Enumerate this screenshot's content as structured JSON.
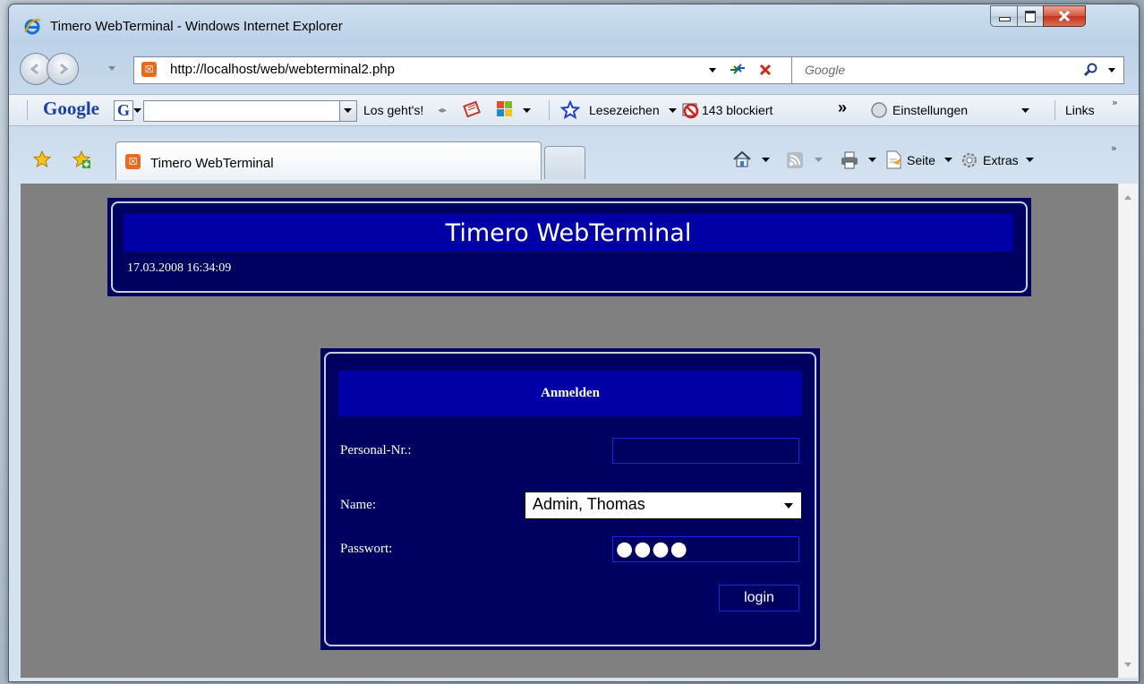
{
  "window": {
    "title": "Timero WebTerminal - Windows Internet Explorer"
  },
  "address_bar": {
    "url": "http://localhost/web/webterminal2.php",
    "search_placeholder": "Google"
  },
  "google_toolbar": {
    "logo": "Google",
    "search_button": "Los geht's!",
    "bookmarks": "Lesezeichen",
    "blocked": "143 blockiert",
    "more": "»",
    "settings": "Einstellungen",
    "links": "Links"
  },
  "tabs": {
    "active_label": "Timero WebTerminal"
  },
  "command_bar": {
    "page_menu": "Seite",
    "tools_menu": "Extras"
  },
  "page": {
    "header_title": "Timero WebTerminal",
    "datetime": "17.03.2008 16:34:09",
    "login": {
      "heading": "Anmelden",
      "personal_nr_label": "Personal-Nr.:",
      "personal_nr_value": "",
      "name_label": "Name:",
      "name_selected": "Admin, Thomas",
      "password_label": "Passwort:",
      "password_mask": "●●●●",
      "login_button": "login"
    }
  },
  "colors": {
    "page_background": "#808080",
    "panel": "#000060",
    "band": "#0000a6"
  }
}
